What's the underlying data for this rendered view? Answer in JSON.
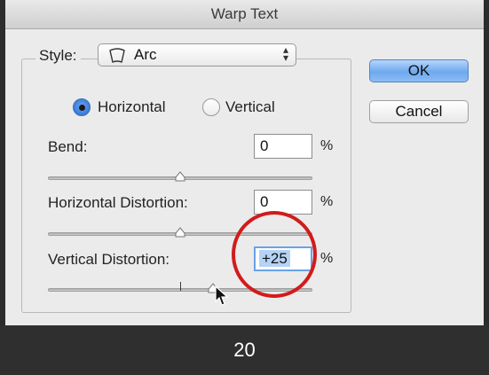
{
  "dialog": {
    "title": "Warp Text",
    "style_label": "Style:",
    "style_value": "Arc",
    "orientation": {
      "horizontal_label": "Horizontal",
      "vertical_label": "Vertical",
      "selected": "Horizontal"
    },
    "bend": {
      "label": "Bend:",
      "value": "0",
      "unit": "%"
    },
    "horizontal_distortion": {
      "label": "Horizontal Distortion:",
      "value": "0",
      "unit": "%"
    },
    "vertical_distortion": {
      "label": "Vertical Distortion:",
      "value": "+25",
      "unit": "%"
    },
    "ok_label": "OK",
    "cancel_label": "Cancel"
  },
  "footer": {
    "page_number": "20"
  },
  "colors": {
    "highlight_circle": "#d21b1b",
    "default_button": "#6ea9f0"
  },
  "icons": [
    "arc-icon",
    "updown-arrows-icon",
    "slider-thumb-icon",
    "mouse-cursor-icon"
  ]
}
